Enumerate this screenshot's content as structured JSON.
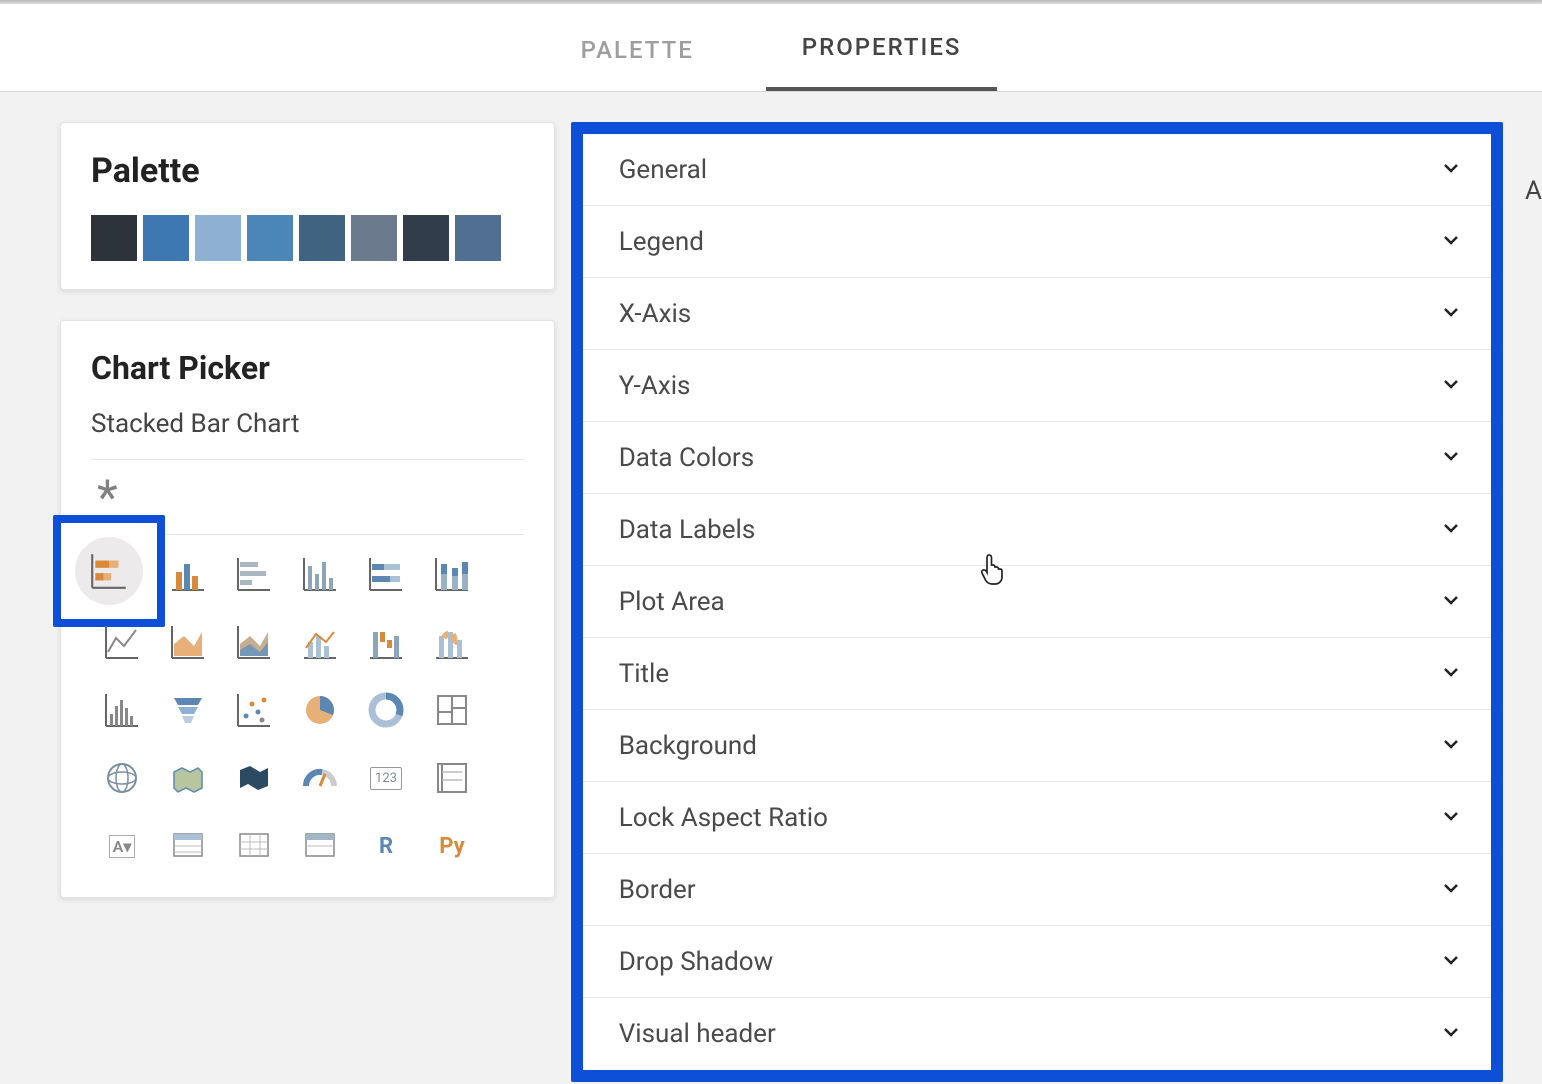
{
  "tabs": {
    "palette": "PALETTE",
    "properties": "PROPERTIES"
  },
  "palette": {
    "title": "Palette",
    "swatches": [
      "#2d3439",
      "#3d78b3",
      "#8eb0d2",
      "#4c86b8",
      "#3f6381",
      "#6b7a8c",
      "#313d4a",
      "#506f91"
    ]
  },
  "picker": {
    "title": "Chart Picker",
    "selected_label": "Stacked Bar Chart",
    "asterisk": "*"
  },
  "properties": {
    "items": [
      "General",
      "Legend",
      "X-Axis",
      "Y-Axis",
      "Data Colors",
      "Data Labels",
      "Plot Area",
      "Title",
      "Background",
      "Lock Aspect Ratio",
      "Border",
      "Drop Shadow",
      "Visual header"
    ]
  },
  "right_cut": "A"
}
